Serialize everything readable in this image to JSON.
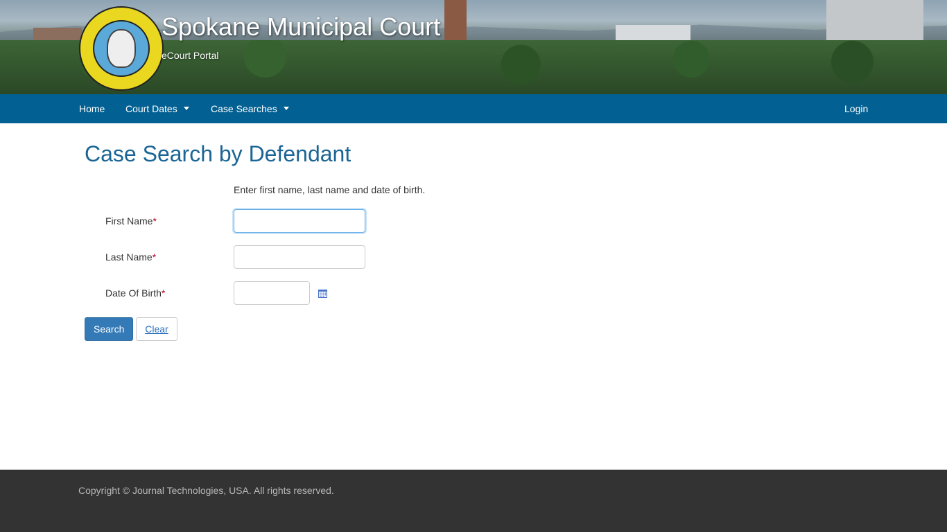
{
  "header": {
    "title": "Spokane Municipal Court",
    "subtitle": "eCourt Portal"
  },
  "nav": {
    "home": "Home",
    "court_dates": "Court Dates",
    "case_searches": "Case Searches",
    "login": "Login"
  },
  "page": {
    "title": "Case Search by Defendant",
    "instructions": "Enter first name, last name and date of birth."
  },
  "form": {
    "first_name_label": "First Name",
    "last_name_label": "Last Name",
    "dob_label": "Date Of Birth",
    "required_mark": "*",
    "first_name_value": "",
    "last_name_value": "",
    "dob_value": ""
  },
  "buttons": {
    "search": "Search",
    "clear": "Clear"
  },
  "footer": {
    "copyright": "Copyright © Journal Technologies, USA. All rights reserved."
  },
  "colors": {
    "nav_bg": "#036092",
    "title": "#1b6595",
    "primary_button": "#337ab7",
    "footer_bg": "#333333"
  }
}
